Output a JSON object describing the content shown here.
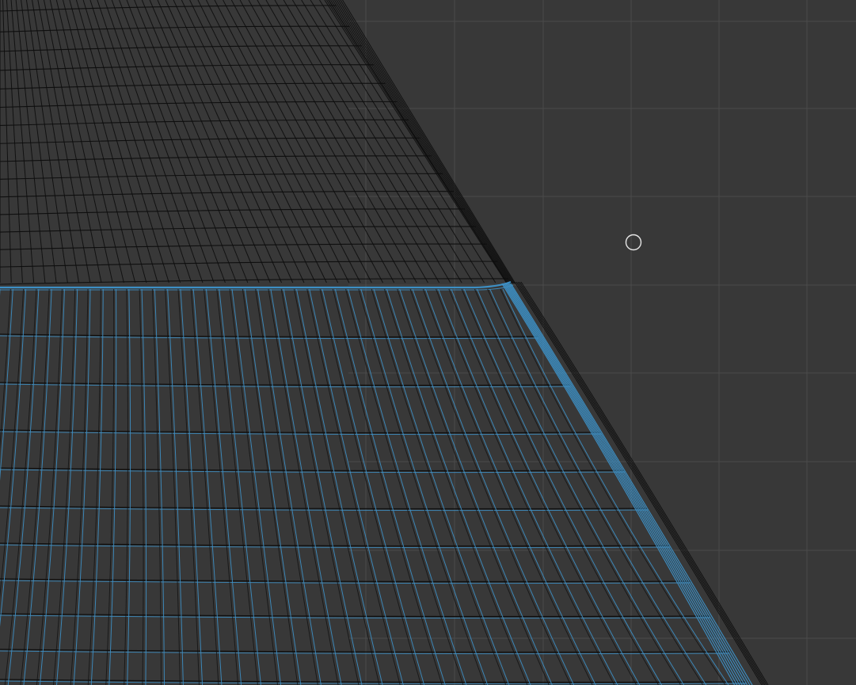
{
  "viewport": {
    "background_color": "#383838",
    "grid_color": "#4a4a4a",
    "wire_color": "#0d0d0d",
    "selection_color": "#3d8fc4",
    "cursor_color": "#e6e6e6",
    "cursor_icon": "circle-brush-cursor-icon"
  }
}
